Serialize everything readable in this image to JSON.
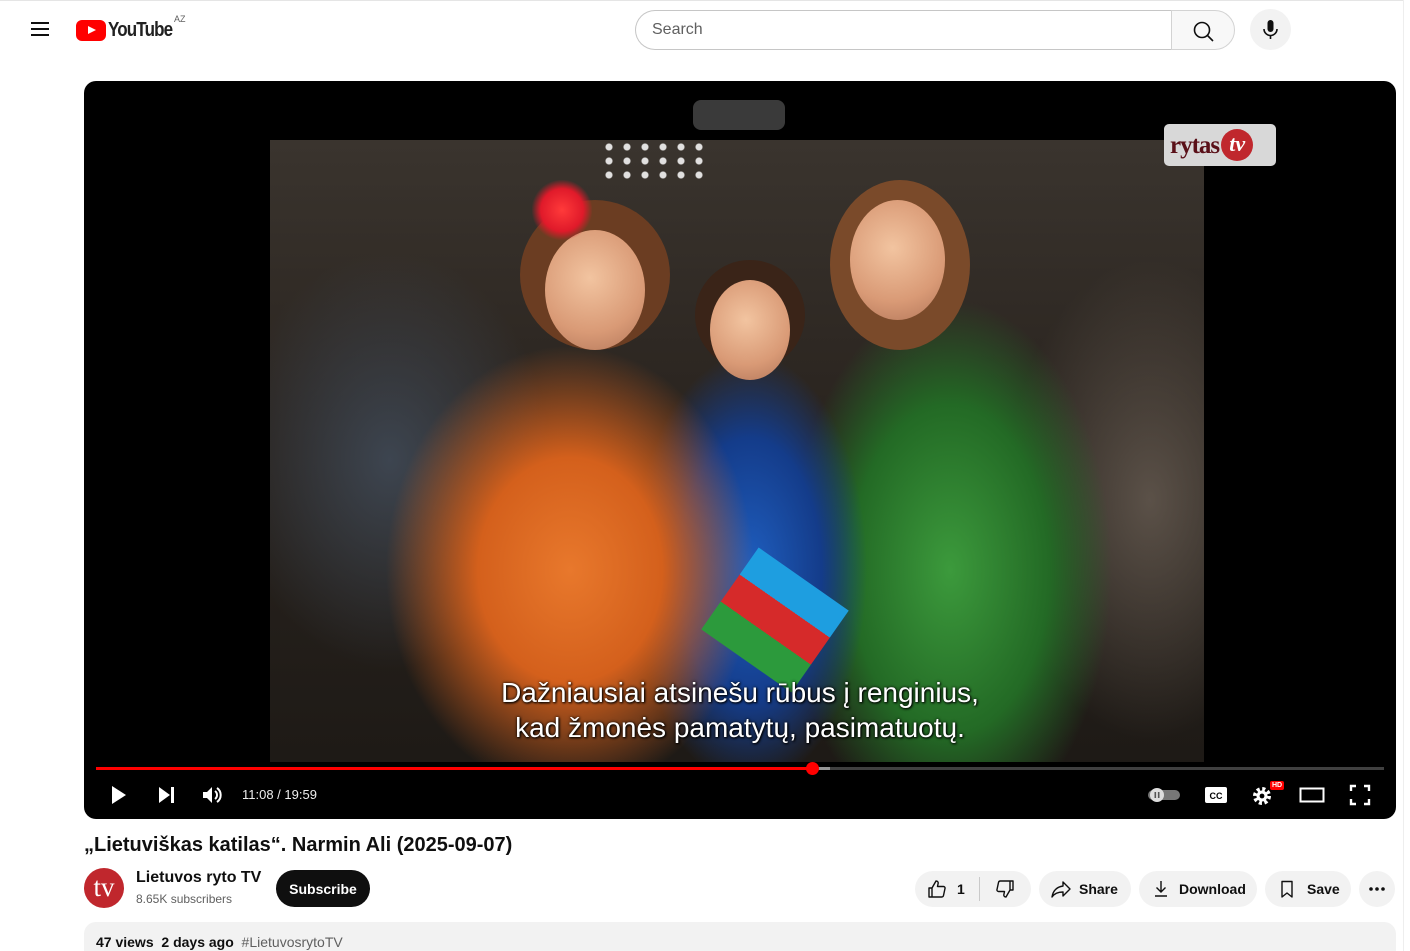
{
  "header": {
    "logo_text": "YouTube",
    "country_code": "AZ",
    "search_placeholder": "Search",
    "search_icon": "search-icon",
    "mic_icon": "mic-icon",
    "menu_icon": "hamburger-menu-icon"
  },
  "video": {
    "watermark_text": "rytas",
    "watermark_badge": "tv",
    "caption_line1": "Dažniausiai atsinešu rūbus į renginius,",
    "caption_line2": "kad žmonės pamatytų, pasimatuotų.",
    "time_display": "11:08 / 19:59",
    "progress_fraction": 0.556,
    "buffered_fraction": 0.57,
    "hd_badge": "HD",
    "colors": {
      "progress": "#ff0000",
      "player_bg": "#000000"
    },
    "controls": [
      "play-icon",
      "next-icon",
      "volume-icon",
      "autoplay-toggle",
      "captions-icon",
      "settings-icon",
      "theater-mode-icon",
      "fullscreen-icon"
    ],
    "cc_label": "CC"
  },
  "info": {
    "title": "„Lietuviškas katilas“. Narmin Ali (2025-09-07)",
    "channel_avatar_text": "tv",
    "channel_name": "Lietuvos ryto TV",
    "subscribers": "8.65K subscribers",
    "subscribe_label": "Subscribe",
    "likes": "1",
    "share_label": "Share",
    "download_label": "Download",
    "save_label": "Save",
    "views": "47 views",
    "age": "2 days ago",
    "hashtag": "#LietuvosrytoTV"
  }
}
